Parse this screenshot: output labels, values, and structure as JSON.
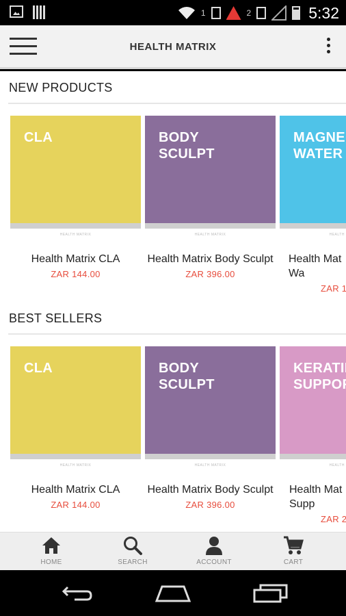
{
  "status_bar": {
    "time": "5:32",
    "sim1": "1",
    "sim2": "2",
    "icons": [
      "image-icon",
      "barcode-icon",
      "wifi-icon",
      "sim-icon",
      "alert-icon",
      "sim-icon",
      "signal-icon",
      "battery-icon"
    ]
  },
  "app_bar": {
    "title": "HEALTH MATRIX",
    "menu_icon": "hamburger-menu-icon",
    "more_icon": "overflow-menu-icon"
  },
  "sections": {
    "new_products": {
      "title": "NEW PRODUCTS",
      "items": [
        {
          "tile_label": "CLA",
          "color": "#e6d35c",
          "name": "Health Matrix CLA",
          "price": "ZAR 144.00"
        },
        {
          "tile_label": "BODY\nSCULPT",
          "color": "#8a6e9b",
          "name": "Health Matrix Body Sculpt",
          "price": "ZAR 396.00"
        },
        {
          "tile_label": "MAGNE\nWATER",
          "color": "#4fc3e8",
          "name": "Health Mat\nWa",
          "price": "ZAR 1"
        }
      ]
    },
    "best_sellers": {
      "title": "BEST SELLERS",
      "items": [
        {
          "tile_label": "CLA",
          "color": "#e6d35c",
          "name": "Health Matrix CLA",
          "price": "ZAR 144.00"
        },
        {
          "tile_label": "BODY\nSCULPT",
          "color": "#8a6e9b",
          "name": "Health Matrix Body Sculpt",
          "price": "ZAR 396.00"
        },
        {
          "tile_label": "KERATIN\nSUPPOR",
          "color": "#d89ac6",
          "name": "Health Mat\nSupp",
          "price": "ZAR 2"
        }
      ]
    }
  },
  "tile_brand": "HEALTH MATRIX",
  "bottom_nav": {
    "home": "HOME",
    "search": "SEARCH",
    "account": "ACCOUNT",
    "cart": "CART"
  },
  "colors": {
    "price": "#e74c3c",
    "app_bar_bg": "#f2f2f2",
    "bottom_nav_bg": "#eeeeee"
  }
}
